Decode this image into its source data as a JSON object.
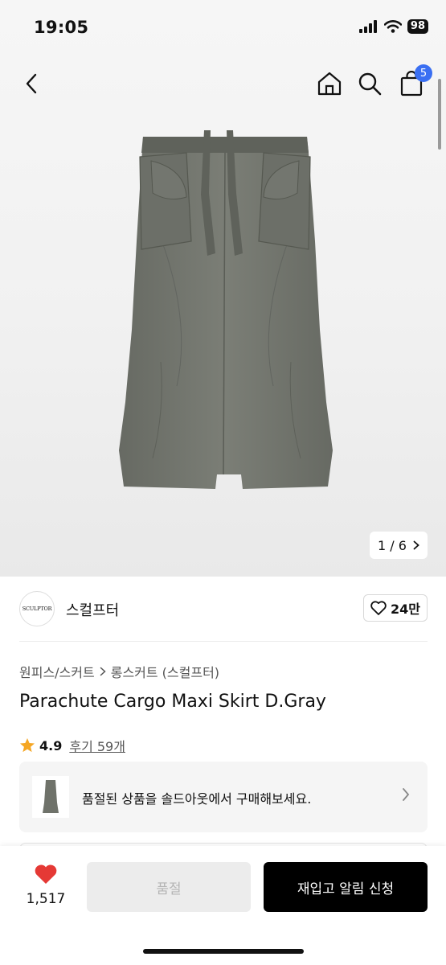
{
  "status_bar": {
    "time": "19:05",
    "battery": "98"
  },
  "nav": {
    "cart_count": "5"
  },
  "gallery": {
    "counter": "1 / 6"
  },
  "brand": {
    "logo_text": "SCULPTOR",
    "name": "스컬프터",
    "likes": "24만"
  },
  "breadcrumb": {
    "category": "원피스/스커트",
    "subcategory": "롱스커트 (스컬프터)"
  },
  "product": {
    "title": "Parachute Cargo Maxi Skirt D.Gray",
    "rating": "4.9",
    "reviews": "후기 59개"
  },
  "soldout_banner": {
    "text": "품절된 상품을 솔드아웃에서 구매해보세요."
  },
  "bottom_bar": {
    "wish_count": "1,517",
    "soldout_label": "품절",
    "restock_label": "재입고 알림 신청"
  },
  "colors": {
    "accent_blue": "#3a6ff2",
    "heart_red": "#e53935",
    "star": "#f5a623",
    "skirt": "#6f726a"
  }
}
